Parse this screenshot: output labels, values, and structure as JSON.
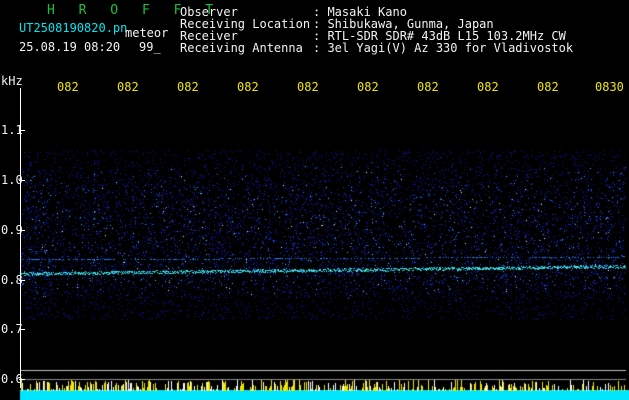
{
  "header": {
    "brand": "H R O F F T",
    "filename": "UT2508190820.pn",
    "type_label": "meteor",
    "datetime": "25.08.19 08:20",
    "count": "99_"
  },
  "info": [
    {
      "label": "Observer",
      "value": ": Masaki Kano"
    },
    {
      "label": "Receiving Location",
      "value": ": Shibukawa, Gunma, Japan"
    },
    {
      "label": "Receiver",
      "value": ": RTL-SDR SDR# 43dB L15 103.2MHz CW"
    },
    {
      "label": "Receiving Antenna",
      "value": ": 3el Yagi(V) Az 330 for Vladivostok"
    }
  ],
  "time_axis": [
    "082",
    "082",
    "082",
    "082",
    "082",
    "082",
    "082",
    "082",
    "082",
    "0830"
  ],
  "freq_axis": {
    "unit": "kHz",
    "labels": [
      "1.1",
      "1.0",
      "0.9",
      "0.8",
      "0.7",
      "0.6"
    ]
  },
  "colors": {
    "background": "#000000",
    "brand": "#18c23a",
    "filename": "#00e6f0",
    "info_text": "#f2f2f2",
    "time_labels": "#f0e600",
    "noise": "#1a2cff",
    "echo_line": "#40ffd0",
    "bottom_bar": "#00e6ff"
  }
}
